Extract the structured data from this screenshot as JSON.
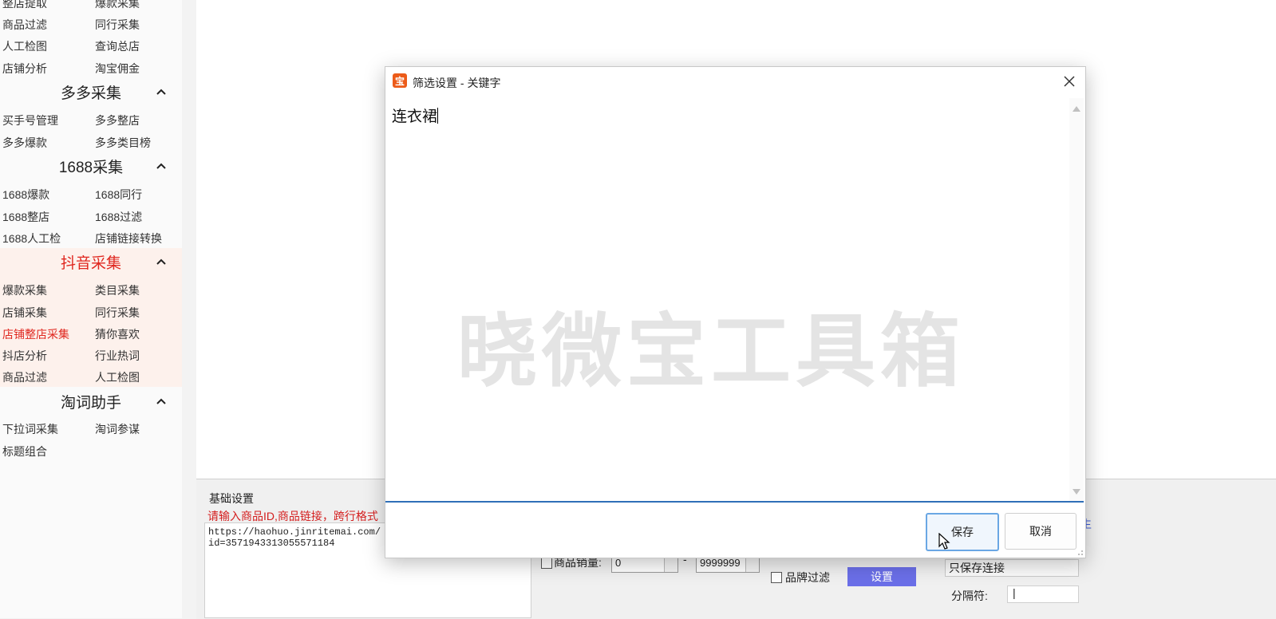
{
  "sidebar": {
    "top_rows": [
      [
        "整店提取",
        "爆款采集"
      ],
      [
        "商品过滤",
        "同行采集"
      ],
      [
        "人工检图",
        "查询总店"
      ],
      [
        "店铺分析",
        "淘宝佣金"
      ]
    ],
    "sections": [
      {
        "title": "多多采集",
        "active": false,
        "rows": [
          [
            "买手号管理",
            "多多整店"
          ],
          [
            "多多爆款",
            "多多类目榜"
          ]
        ]
      },
      {
        "title": "1688采集",
        "active": false,
        "rows": [
          [
            "1688爆款",
            "1688同行"
          ],
          [
            "1688整店",
            "1688过滤"
          ],
          [
            "1688人工检",
            "店铺链接转换"
          ]
        ]
      },
      {
        "title": "抖音采集",
        "active": true,
        "rows": [
          [
            "爆款采集",
            "类目采集"
          ],
          [
            "店铺采集",
            "同行采集"
          ],
          [
            "店铺整店采集",
            "猜你喜欢"
          ],
          [
            "抖店分析",
            "行业热词"
          ],
          [
            "商品过滤",
            "人工检图"
          ]
        ],
        "highlighted_item": "店铺整店采集"
      },
      {
        "title": "淘词助手",
        "active": false,
        "rows": [
          [
            "下拉词采集",
            "淘词参谋"
          ],
          [
            "标题组合",
            ""
          ]
        ]
      }
    ]
  },
  "bottom_panel": {
    "group_title": "基础设置",
    "hint": "请输入商品ID,商品链接，跨行格式",
    "url_text": "https://haohuo.jinritemai.com/\nid=3571943313055571184",
    "sales_label": "商品销量:",
    "sales_min": "0",
    "sales_max": "9999999",
    "brand_filter_label": "品牌过滤",
    "brand_set_label": "设置",
    "save_mode": "只保存连接",
    "separator_label": "分隔符:",
    "separator_value": "|",
    "right_link": "生"
  },
  "dialog": {
    "title": "筛选设置 - 关键字",
    "app_icon": "宝",
    "editor_text": "连衣裙",
    "watermark": "晓微宝工具箱",
    "save_label": "保存",
    "cancel_label": "取消"
  },
  "colors": {
    "accent_red": "#e0271f",
    "app_icon_orange": "#ec5b19",
    "set_button": "#6b6fe8",
    "editor_focus": "#2f6fb8"
  },
  "icons": {
    "section_toggle": "chevron-up-icon",
    "close": "close-icon",
    "cursor": "mouse-pointer-icon"
  }
}
